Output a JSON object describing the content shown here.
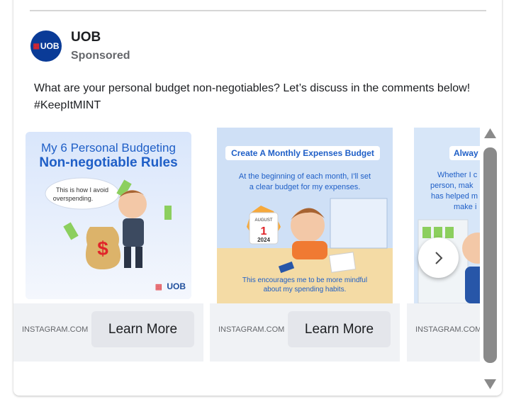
{
  "post": {
    "page_name": "UOB",
    "sponsored_label": "Sponsored",
    "avatar_text": "UOB",
    "text": "What are your personal budget non-negotiables? Let’s discuss in the comments below! #KeepItMINT"
  },
  "carousel": {
    "items": [
      {
        "title_line1": "My 6 Personal Budgeting",
        "title_line2": "Non-negotiable Rules",
        "bubble_line1": "This is how I avoid",
        "bubble_line2": "overspending.",
        "logo_text": "UOB",
        "domain": "INSTAGRAM.COM",
        "cta": "Learn More"
      },
      {
        "title": "Create A Monthly Expenses Budget",
        "body_line1": "At the beginning of each month, I'll set",
        "body_line2": "a clear budget for my expenses.",
        "calendar_month": "AUGUST",
        "calendar_day": "1",
        "calendar_year": "2024",
        "caption_line1": "This encourages me to be more mindful",
        "caption_line2": "about my spending habits.",
        "domain": "INSTAGRAM.COM",
        "cta": "Learn More"
      },
      {
        "title": "Alway",
        "body_line1": "Whether I c",
        "body_line2": "person, mak",
        "body_line3": "has helped m",
        "body_line4": "make i",
        "domain": "INSTAGRAM.COM"
      }
    ]
  },
  "colors": {
    "uob_blue": "#0a3b97",
    "uob_red": "#e0252a",
    "title_blue": "#1f5fc7"
  },
  "icons": {
    "next": "chevron-right-icon",
    "scroll_up": "triangle-up-icon",
    "scroll_down": "triangle-down-icon"
  }
}
